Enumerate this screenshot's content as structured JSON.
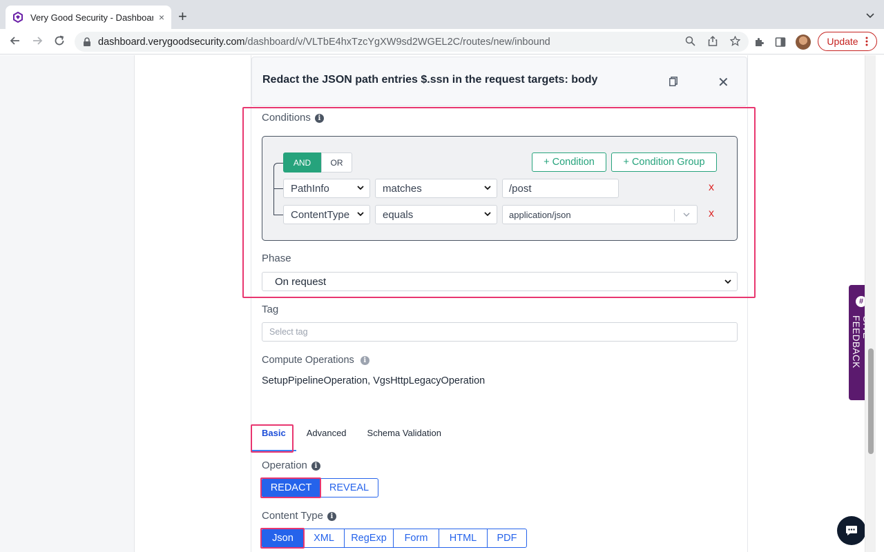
{
  "browser": {
    "tab_title": "Very Good Security - Dashboard",
    "tab_close": "×",
    "new_tab": "+",
    "url_host": "dashboard.verygoodsecurity.com",
    "url_path": "/dashboard/v/VLTbE4hxTzcYgXW9sd2WGEL2C/routes/new/inbound",
    "update_label": "Update"
  },
  "panel": {
    "title": "Redact the JSON path entries $.ssn in the request targets: body",
    "close": "✕"
  },
  "conditions": {
    "label": "Conditions",
    "and_label": "AND",
    "or_label": "OR",
    "add_condition": "+ Condition",
    "add_condition_group": "+ Condition Group",
    "rows": [
      {
        "field": "PathInfo",
        "operator": "matches",
        "value": "/post"
      },
      {
        "field": "ContentType",
        "operator": "equals",
        "value": "application/json"
      }
    ],
    "remove_label": "x"
  },
  "phase": {
    "label": "Phase",
    "value": "On request"
  },
  "tag": {
    "label": "Tag",
    "placeholder": "Select tag"
  },
  "compute": {
    "label": "Compute Operations",
    "value": "SetupPipelineOperation, VgsHttpLegacyOperation"
  },
  "tabs": [
    {
      "label": "Basic",
      "active": true
    },
    {
      "label": "Advanced",
      "active": false
    },
    {
      "label": "Schema Validation",
      "active": false
    }
  ],
  "operation": {
    "label": "Operation",
    "options": [
      "REDACT",
      "REVEAL"
    ],
    "selected": "REDACT"
  },
  "content_type": {
    "label": "Content Type",
    "options": [
      "Json",
      "XML",
      "RegExp",
      "Form",
      "HTML",
      "PDF"
    ],
    "selected": "Json"
  },
  "feedback": {
    "label": "GIVE FEEDBACK"
  },
  "colors": {
    "accent_green": "#26a37c",
    "accent_blue": "#2563eb",
    "highlight": "#e8366f",
    "feedback_bg": "#5b1a6e"
  }
}
